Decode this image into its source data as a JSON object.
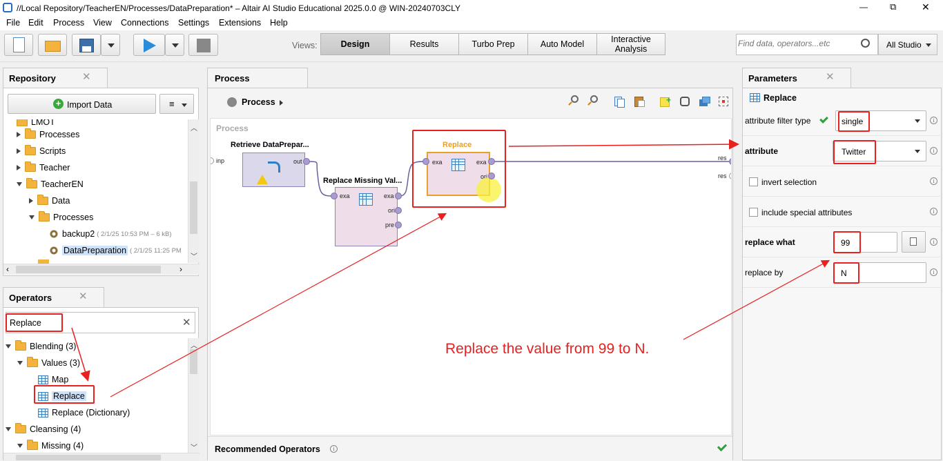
{
  "window": {
    "title": "//Local Repository/TeacherEN/Processes/DataPreparation* – Altair AI Studio Educational 2025.0.0 @ WIN-20240703CLY",
    "minimize": "—",
    "restore": "⧉",
    "close": "✕"
  },
  "menu": [
    "File",
    "Edit",
    "Process",
    "View",
    "Connections",
    "Settings",
    "Extensions",
    "Help"
  ],
  "toolbar": {
    "views_label": "Views:",
    "views": [
      "Design",
      "Results",
      "Turbo Prep",
      "Auto Model",
      "Interactive Analysis"
    ],
    "active_view": "Design",
    "search_placeholder": "Find data, operators...etc",
    "studio_label": "All Studio"
  },
  "repository": {
    "tab": "Repository",
    "import_label": "Import Data",
    "items": [
      {
        "label": "LMOT",
        "level": 1
      },
      {
        "label": "Processes",
        "level": 1
      },
      {
        "label": "Scripts",
        "level": 1
      },
      {
        "label": "Teacher",
        "level": 1
      },
      {
        "label": "TeacherEN",
        "level": 1
      },
      {
        "label": "Data",
        "level": 2
      },
      {
        "label": "Processes",
        "level": 2
      },
      {
        "label": "backup2",
        "meta": "( 2/1/25 10:53 PM – 6 kB)",
        "level": 3
      },
      {
        "label": "DataPreparation",
        "meta": "( 2/1/25 11:25 PM",
        "level": 3
      }
    ]
  },
  "operators": {
    "tab": "Operators",
    "search_value": "Replace",
    "items": [
      {
        "label": "Blending (3)",
        "level": 0
      },
      {
        "label": "Values (3)",
        "level": 1
      },
      {
        "label": "Map",
        "level": 2
      },
      {
        "label": "Replace",
        "level": 2
      },
      {
        "label": "Replace (Dictionary)",
        "level": 2
      },
      {
        "label": "Cleansing (4)",
        "level": 0
      },
      {
        "label": "Missing (4)",
        "level": 1
      }
    ]
  },
  "process": {
    "tab": "Process",
    "breadcrumb": "Process",
    "canvas_label": "Process",
    "op1": {
      "title": "Retrieve DataPrepar...",
      "ports": {
        "in": "inp",
        "out": "out"
      }
    },
    "op2": {
      "title": "Replace Missing Val...",
      "ports": {
        "in": "exa",
        "out1": "exa",
        "out2": "ori",
        "out3": "pre"
      }
    },
    "op3": {
      "title": "Replace",
      "ports": {
        "in": "exa",
        "out1": "exa",
        "out2": "ori"
      }
    },
    "result_ports": [
      "res",
      "res"
    ],
    "recommended": "Recommended Operators"
  },
  "parameters": {
    "tab": "Parameters",
    "operator": "Replace",
    "filter_type_label": "attribute filter type",
    "filter_type_value": "single",
    "attribute_label": "attribute",
    "attribute_value": "Twitter",
    "invert_label": "invert selection",
    "special_label": "include special attributes",
    "replace_what_label": "replace what",
    "replace_what_value": "99",
    "replace_by_label": "replace by",
    "replace_by_value": "N"
  },
  "annotation": "Replace the value from 99 to N.",
  "colors": {
    "annotation": "#e82020",
    "operator_border": "#e8a028",
    "operator_fill": "#efdde9"
  }
}
